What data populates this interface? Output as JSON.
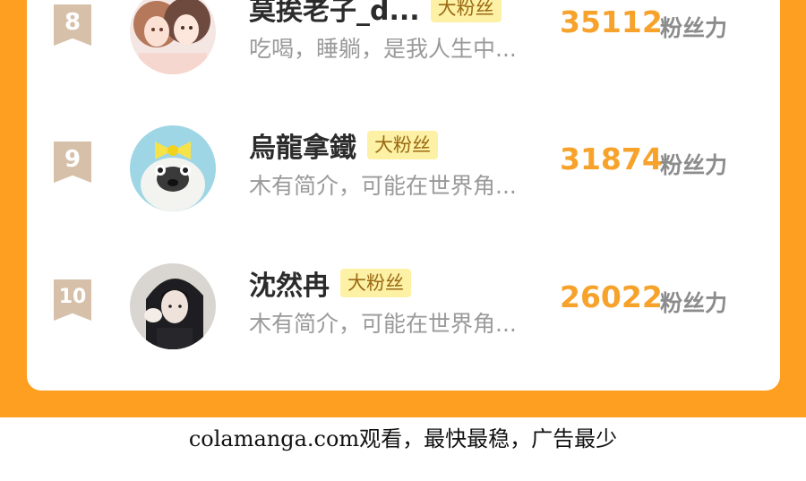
{
  "ranking": {
    "entries": [
      {
        "rank": "8",
        "name": "莫挨老子_d...",
        "badge": "大粉丝",
        "bio": "吃喝，睡躺，是我人生中...",
        "score": "35112",
        "unit": "粉丝力",
        "avatar": "anime-girls-avatar"
      },
      {
        "rank": "9",
        "name": "烏龍拿鐵",
        "badge": "大粉丝",
        "bio": "木有简介，可能在世界角...",
        "score": "31874",
        "unit": "粉丝力",
        "avatar": "pug-bow-avatar"
      },
      {
        "rank": "10",
        "name": "沈然冉",
        "badge": "大粉丝",
        "bio": "木有简介，可能在世界角...",
        "score": "26022",
        "unit": "粉丝力",
        "avatar": "anime-man-avatar"
      }
    ]
  },
  "footer": {
    "text": "colamanga.com观看，最快最稳，广告最少"
  },
  "colors": {
    "panel": "#ff9f22",
    "rank_badge": "#d6c0aa",
    "score": "#f7a22b",
    "badge_bg": "#fdf1a6"
  }
}
